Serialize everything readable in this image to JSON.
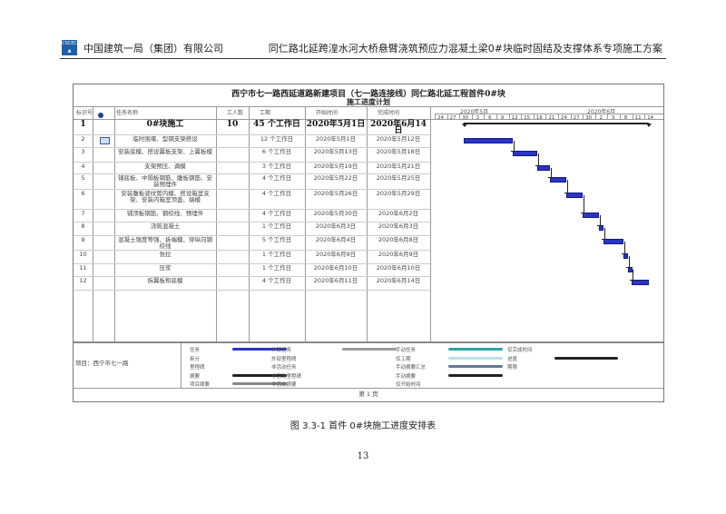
{
  "header": {
    "company": "中国建筑一局（集团）有限公司",
    "logo_text": "CSCEC",
    "doc_title": "同仁路北延跨湟水河大桥悬臂浇筑预应力混凝土梁0#块临时固结及支撑体系专项施工方案"
  },
  "gantt": {
    "title": "西宁市七一路西延道路新建项目（七一路连接线）同仁路北延工程首件0#块",
    "subtitle": "施工进度计划",
    "columns": [
      "标识号",
      "任务名称",
      "工人数",
      "工期",
      "开始时间",
      "完成时间"
    ],
    "months": [
      "2020年5月",
      "2020年6月"
    ],
    "ticks": [
      "24",
      "27",
      "30",
      "3",
      "6",
      "9",
      "12",
      "15",
      "18",
      "21",
      "24",
      "27",
      "30",
      "2",
      "5",
      "8",
      "11",
      "14"
    ],
    "rows": [
      {
        "id": "1",
        "name": "0#块施工",
        "workers": "10",
        "duration": "45 个工作日",
        "start": "2020年5月1日",
        "end": "2020年6月14日",
        "summary": true
      },
      {
        "id": "2",
        "name": "临时围堰、型钢支架搭设",
        "workers": "",
        "duration": "12 个工作日",
        "start": "2020年5月1日",
        "end": "2020年5月12日"
      },
      {
        "id": "3",
        "name": "安装底模、搭设翼板支架、上翼板模",
        "workers": "",
        "duration": "6 个工作日",
        "start": "2020年5月13日",
        "end": "2020年5月18日"
      },
      {
        "id": "4",
        "name": "支架预压、调模",
        "workers": "",
        "duration": "3 个工作日",
        "start": "2020年5月19日",
        "end": "2020年5月21日"
      },
      {
        "id": "5",
        "name": "铺底板、中隔板钢筋、腹板钢筋、安装预埋件",
        "workers": "",
        "duration": "4 个工作日",
        "start": "2020年5月22日",
        "end": "2020年5月25日"
      },
      {
        "id": "6",
        "name": "安装腹板波纹管内模、搭设箱室支架、安装内箱室顶盖、端模",
        "workers": "",
        "duration": "4 个工作日",
        "start": "2020年5月26日",
        "end": "2020年5月29日"
      },
      {
        "id": "7",
        "name": "铺顶板钢筋、钢绞线、预埋件",
        "workers": "",
        "duration": "4 个工作日",
        "start": "2020年5月30日",
        "end": "2020年6月2日"
      },
      {
        "id": "8",
        "name": "浇筑混凝土",
        "workers": "",
        "duration": "1 个工作日",
        "start": "2020年6月3日",
        "end": "2020年6月3日"
      },
      {
        "id": "9",
        "name": "混凝土强度等强、拆端模、穿纵向钢绞线",
        "workers": "",
        "duration": "5 个工作日",
        "start": "2020年6月4日",
        "end": "2020年6月8日"
      },
      {
        "id": "10",
        "name": "张拉",
        "workers": "",
        "duration": "1 个工作日",
        "start": "2020年6月9日",
        "end": "2020年6月9日"
      },
      {
        "id": "11",
        "name": "压浆",
        "workers": "",
        "duration": "1 个工作日",
        "start": "2020年6月10日",
        "end": "2020年6月10日"
      },
      {
        "id": "12",
        "name": "拆翼板和底模",
        "workers": "",
        "duration": "4 个工作日",
        "start": "2020年6月11日",
        "end": "2020年6月14日"
      }
    ],
    "legend": {
      "project": "项目：西宁市七一路",
      "items": [
        "任务",
        "拆分",
        "里程碑",
        "摘要",
        "项目摘要",
        "外部任务",
        "外部里程碑",
        "非活动任务",
        "非活动里程碑",
        "非活动摘要",
        "手动任务",
        "仅工期",
        "手动摘要汇总",
        "手动摘要",
        "仅开始时间",
        "仅完成时间",
        "进度",
        "期限"
      ]
    },
    "footer": "第 1 页",
    "colors": {
      "task": "#2b34c8",
      "summary": "#222222",
      "manual": "#2aa6a6"
    }
  },
  "caption": "图 3.3-1 首件 0#块施工进度安排表",
  "page_number": "13"
}
